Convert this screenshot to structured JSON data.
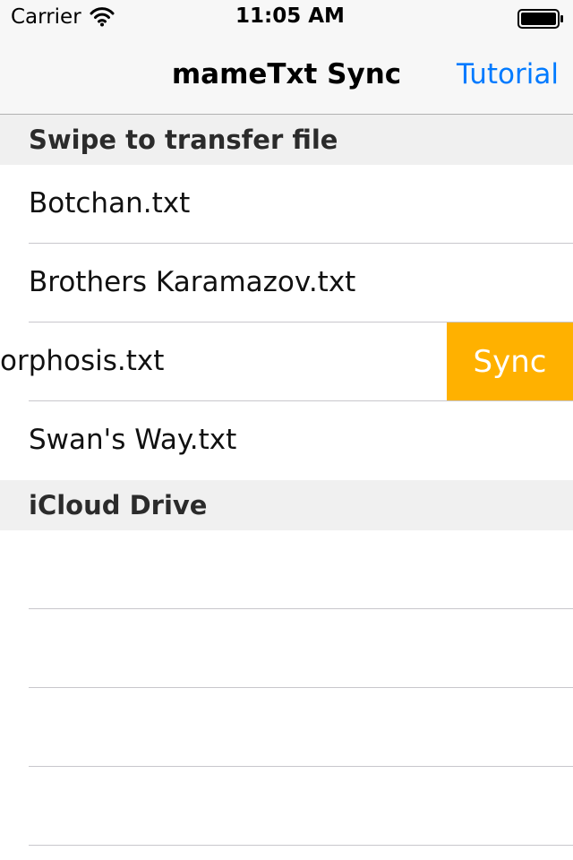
{
  "status_bar": {
    "carrier": "Carrier",
    "time": "11:05 AM",
    "wifi_icon": "wifi-icon",
    "battery_icon": "battery-full-icon"
  },
  "nav": {
    "title": "mameTxt Sync",
    "right_button": "Tutorial",
    "accent_color": "#007aff"
  },
  "sections": [
    {
      "header": "Swipe to transfer file",
      "rows": [
        {
          "label": "Botchan.txt"
        },
        {
          "label": "Brothers Karamazov.txt"
        },
        {
          "label": "orphosis.txt",
          "swipe_action": "Sync",
          "swiped_open": true
        },
        {
          "label": "Swan's Way.txt"
        }
      ]
    },
    {
      "header": "iCloud Drive",
      "rows": [
        {
          "label": ""
        },
        {
          "label": ""
        },
        {
          "label": ""
        },
        {
          "label": ""
        }
      ]
    }
  ],
  "colors": {
    "sync_action": "#ffb100",
    "section_background": "#f0f0f0",
    "separator": "#c8c7cc"
  }
}
